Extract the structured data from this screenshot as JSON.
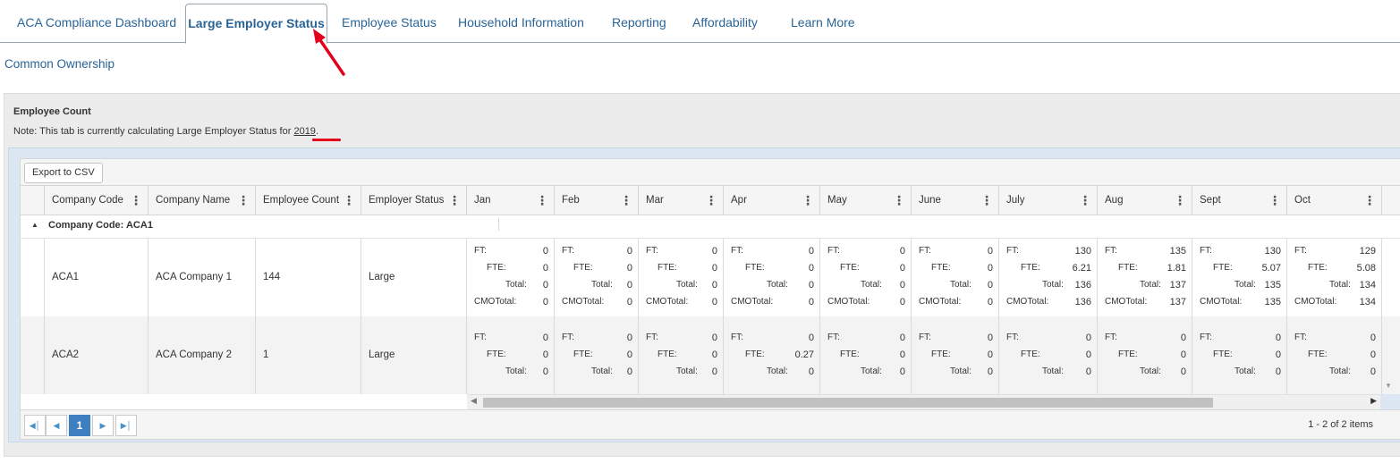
{
  "tabs": [
    {
      "label": "ACA Compliance Dashboard"
    },
    {
      "label": "Large Employer Status"
    },
    {
      "label": "Employee Status"
    },
    {
      "label": "Household Information"
    },
    {
      "label": "Reporting"
    },
    {
      "label": "Affordability"
    },
    {
      "label": "Learn More"
    }
  ],
  "subtab": "Common Ownership",
  "panel": {
    "title": "Employee Count",
    "note_prefix": "Note: This tab is currently calculating Large Employer Status for ",
    "year": "2019",
    "note_suffix": "."
  },
  "toolbar": {
    "export_label": "Export to CSV"
  },
  "columns": [
    "Company Code",
    "Company Name",
    "Employee Count",
    "Employer Status",
    "Jan",
    "Feb",
    "Mar",
    "Apr",
    "May",
    "June",
    "July",
    "Aug",
    "Sept",
    "Oct"
  ],
  "group": {
    "label": "Company Code: ACA1"
  },
  "metric_labels": {
    "ft": "FT:",
    "fte": "FTE:",
    "total": "Total:",
    "cmo": "CMOTotal:"
  },
  "rows": [
    {
      "code": "ACA1",
      "name": "ACA Company 1",
      "count": "144",
      "status": "Large",
      "months": [
        {
          "ft": "0",
          "fte": "0",
          "total": "0",
          "cmo": "0"
        },
        {
          "ft": "0",
          "fte": "0",
          "total": "0",
          "cmo": "0"
        },
        {
          "ft": "0",
          "fte": "0",
          "total": "0",
          "cmo": "0"
        },
        {
          "ft": "0",
          "fte": "0",
          "total": "0",
          "cmo": "0"
        },
        {
          "ft": "0",
          "fte": "0",
          "total": "0",
          "cmo": "0"
        },
        {
          "ft": "0",
          "fte": "0",
          "total": "0",
          "cmo": "0"
        },
        {
          "ft": "130",
          "fte": "6.21",
          "total": "136",
          "cmo": "136"
        },
        {
          "ft": "135",
          "fte": "1.81",
          "total": "137",
          "cmo": "137"
        },
        {
          "ft": "130",
          "fte": "5.07",
          "total": "135",
          "cmo": "135"
        },
        {
          "ft": "129",
          "fte": "5.08",
          "total": "134",
          "cmo": "134"
        }
      ]
    },
    {
      "code": "ACA2",
      "name": "ACA Company 2",
      "count": "1",
      "status": "Large",
      "months": [
        {
          "ft": "0",
          "fte": "0",
          "total": "0"
        },
        {
          "ft": "0",
          "fte": "0",
          "total": "0"
        },
        {
          "ft": "0",
          "fte": "0",
          "total": "0"
        },
        {
          "ft": "0",
          "fte": "0.27",
          "total": "0"
        },
        {
          "ft": "0",
          "fte": "0",
          "total": "0"
        },
        {
          "ft": "0",
          "fte": "0",
          "total": "0"
        },
        {
          "ft": "0",
          "fte": "0",
          "total": "0"
        },
        {
          "ft": "0",
          "fte": "0",
          "total": "0"
        },
        {
          "ft": "0",
          "fte": "0",
          "total": "0"
        },
        {
          "ft": "0",
          "fte": "0",
          "total": "0"
        }
      ]
    }
  ],
  "pager": {
    "current_page": "1",
    "info": "1 - 2 of 2 items"
  },
  "colors": {
    "link": "#2a6496",
    "accent": "#3d7fc1",
    "annotation": "#e3001b"
  }
}
